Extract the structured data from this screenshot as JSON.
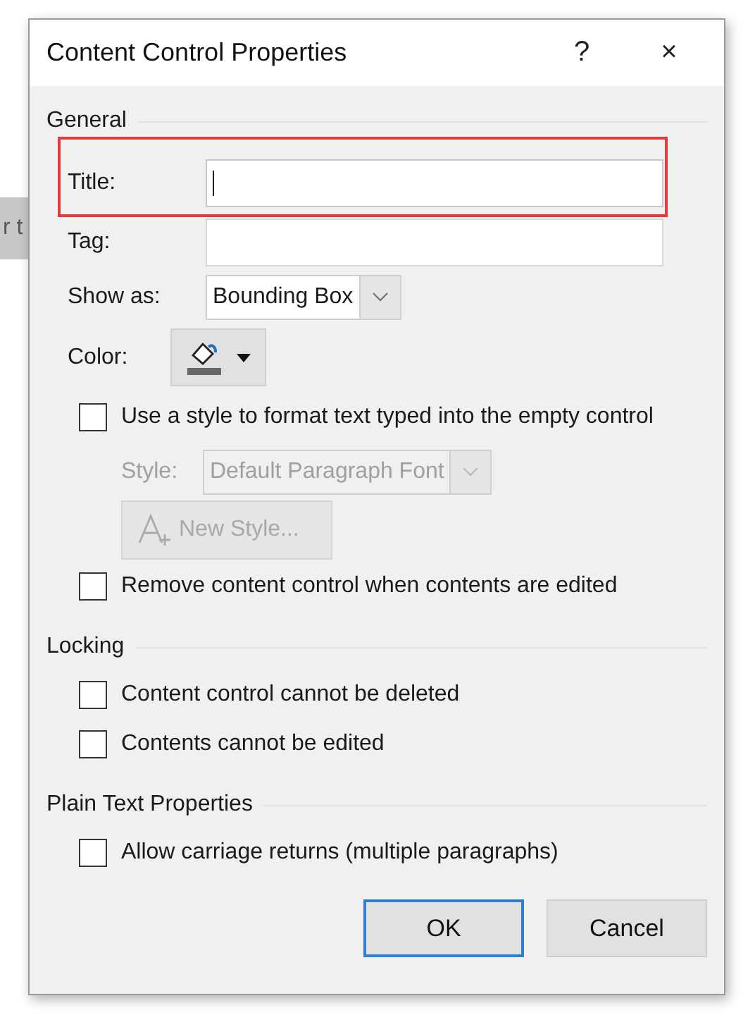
{
  "background": {
    "text": "r t"
  },
  "dialog": {
    "title": "Content Control Properties",
    "help": "?",
    "close": "×"
  },
  "general": {
    "heading": "General",
    "title_field": {
      "label": "Title:",
      "focused": true,
      "highlighted": true
    },
    "tag_field": {
      "label": "Tag:"
    },
    "show_as": {
      "label": "Show as:",
      "value": "Bounding Box",
      "disabled": false
    },
    "color": {
      "label": "Color:"
    },
    "use_style": {
      "label": "Use a style to format text typed into the empty control",
      "checked": false
    },
    "style": {
      "label": "Style:",
      "value": "Default Paragraph Font",
      "disabled": true
    },
    "new_style": {
      "label": "New Style...",
      "disabled": true
    },
    "remove": {
      "label": "Remove content control when contents are edited",
      "checked": false
    }
  },
  "locking": {
    "heading": "Locking",
    "options": [
      {
        "label": "Content control cannot be deleted",
        "checked": false
      },
      {
        "label": "Contents cannot be edited",
        "checked": false
      }
    ]
  },
  "plain_text": {
    "heading": "Plain Text Properties",
    "options": [
      {
        "label": "Allow carriage returns (multiple paragraphs)",
        "checked": false
      }
    ]
  },
  "buttons": [
    {
      "label": "OK",
      "default": true
    },
    {
      "label": "Cancel",
      "default": false
    }
  ]
}
